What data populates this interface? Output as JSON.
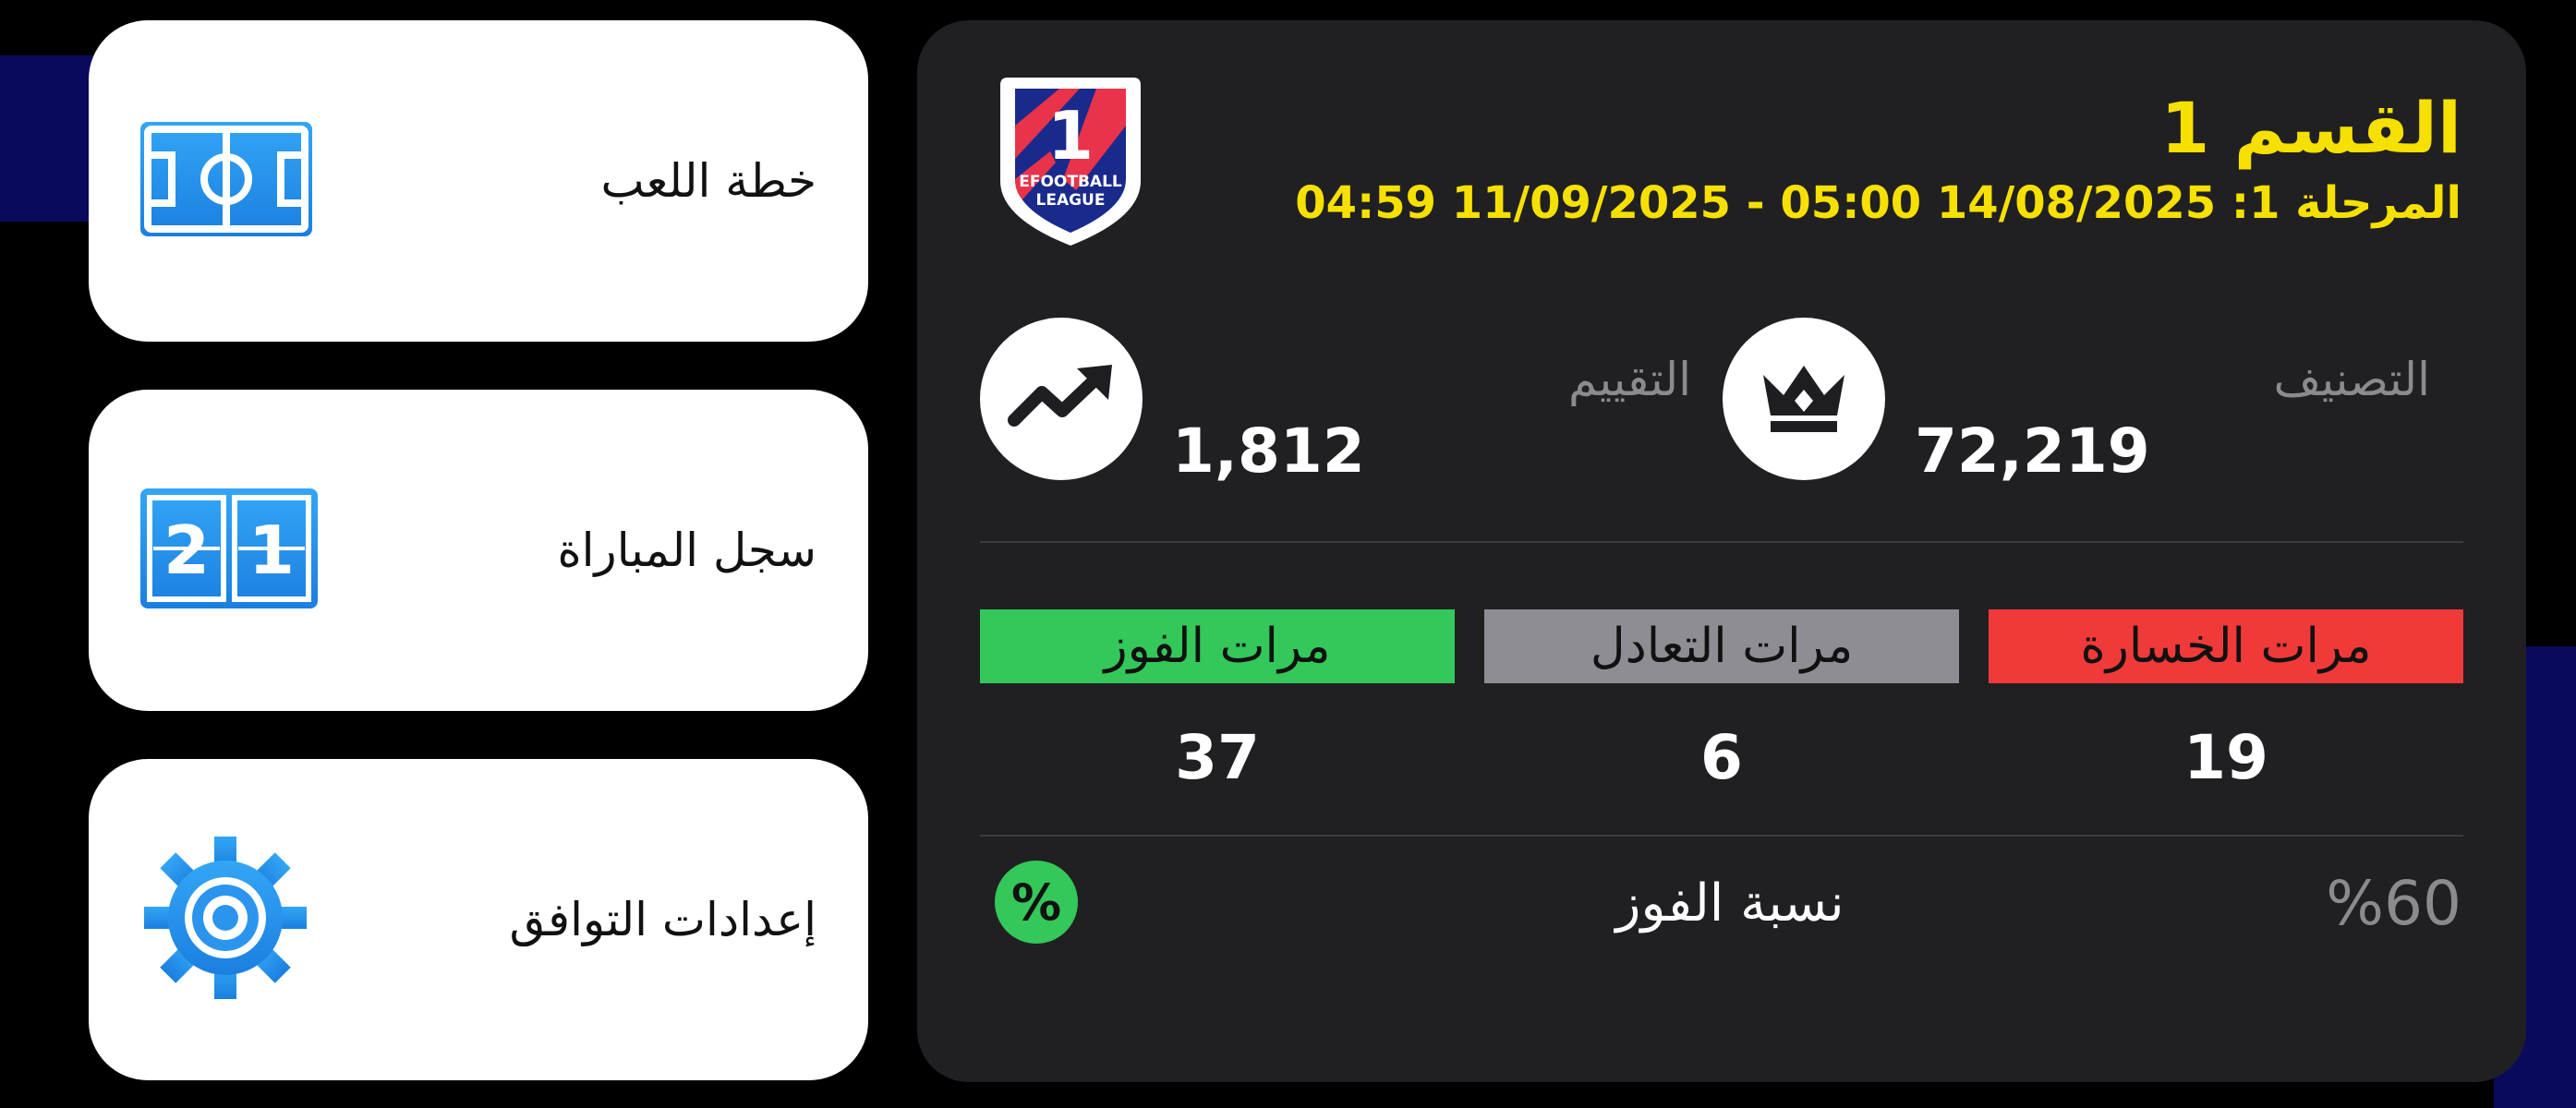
{
  "menu": [
    {
      "label": "خطة اللعب",
      "icon": "formation-pitch-icon"
    },
    {
      "label": "سجل المباراة",
      "icon": "scoreboard-icon"
    },
    {
      "label": "إعدادات التوافق",
      "icon": "gear-icon"
    }
  ],
  "scoreboard": {
    "home": "2",
    "away": "1"
  },
  "division": {
    "title": "القسم 1",
    "stage": "المرحلة 1: 14/08/2025 05:00 - 11/09/2025 04:59",
    "badge_number": "1",
    "badge_text_line1": "EFOOTBALL",
    "badge_text_line2": "LEAGUE"
  },
  "ranking": {
    "label": "التصنيف",
    "value": "72,219",
    "icon": "crown-icon"
  },
  "rating": {
    "label": "التقييم",
    "value": "1,812",
    "icon": "trend-up-icon"
  },
  "results": {
    "losses_label": "مرات الخسارة",
    "losses": "19",
    "draws_label": "مرات التعادل",
    "draws": "6",
    "wins_label": "مرات الفوز",
    "wins": "37"
  },
  "win_rate": {
    "label": "نسبة الفوز",
    "value": "%60",
    "icon": "percent-icon"
  },
  "colors": {
    "accent_yellow": "#f6e000",
    "loss_red": "#f03a3a",
    "draw_gray": "#8d8d93",
    "win_green": "#34c759",
    "icon_blue": "#1e88e5"
  }
}
